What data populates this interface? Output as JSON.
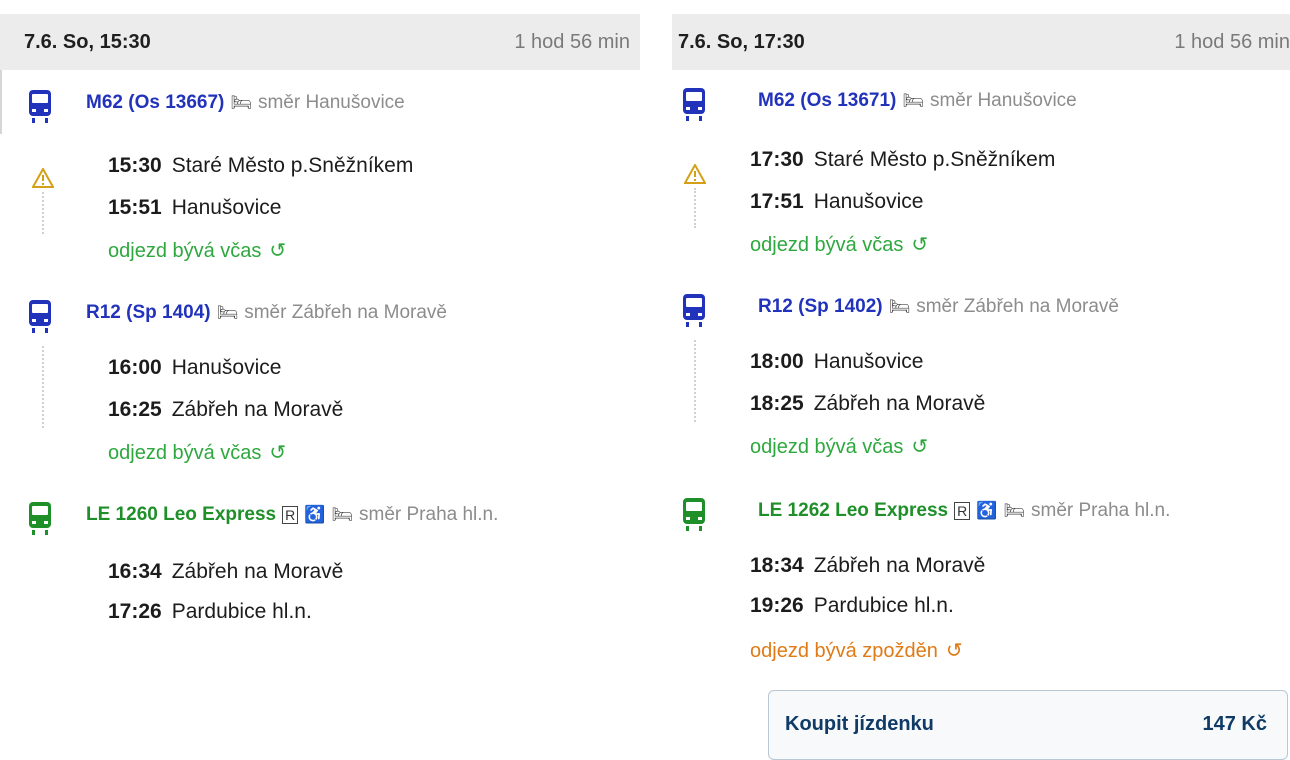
{
  "left": {
    "header": {
      "date": "7.6. So, 15:30",
      "duration": "1 hod 56 min"
    },
    "segments": [
      {
        "code": "M62 (Os 13667)",
        "direction": "směr Hanušovice",
        "stops": [
          {
            "time": "15:30",
            "station": "Staré Město p.Sněžníkem"
          },
          {
            "time": "15:51",
            "station": "Hanušovice"
          }
        ],
        "status": "odjezd bývá včas"
      },
      {
        "code": "R12 (Sp 1404)",
        "direction": "směr Zábřeh na Moravě",
        "stops": [
          {
            "time": "16:00",
            "station": "Hanušovice"
          },
          {
            "time": "16:25",
            "station": "Zábřeh na Moravě"
          }
        ],
        "status": "odjezd bývá včas"
      },
      {
        "code": "LE 1260 Leo Express",
        "reservation": "R",
        "direction": "směr Praha hl.n.",
        "stops": [
          {
            "time": "16:34",
            "station": "Zábřeh na Moravě"
          },
          {
            "time": "17:26",
            "station": "Pardubice hl.n."
          }
        ]
      }
    ]
  },
  "right": {
    "header": {
      "date": "7.6. So, 17:30",
      "duration": "1 hod 56 min"
    },
    "segments": [
      {
        "code": "M62 (Os 13671)",
        "direction": "směr Hanušovice",
        "stops": [
          {
            "time": "17:30",
            "station": "Staré Město p.Sněžníkem"
          },
          {
            "time": "17:51",
            "station": "Hanušovice"
          }
        ],
        "status": "odjezd bývá včas"
      },
      {
        "code": "R12 (Sp 1402)",
        "direction": "směr Zábřeh na Moravě",
        "stops": [
          {
            "time": "18:00",
            "station": "Hanušovice"
          },
          {
            "time": "18:25",
            "station": "Zábřeh na Moravě"
          }
        ],
        "status": "odjezd bývá včas"
      },
      {
        "code": "LE 1262 Leo Express",
        "reservation": "R",
        "direction": "směr Praha hl.n.",
        "stops": [
          {
            "time": "18:34",
            "station": "Zábřeh na Moravě"
          },
          {
            "time": "19:26",
            "station": "Pardubice hl.n."
          }
        ],
        "status": "odjezd bývá zpožděn"
      }
    ],
    "buy": {
      "label": "Koupit jízdenku",
      "price": "147 Kč"
    }
  },
  "icons": {
    "train": "train-icon",
    "warning": "warning-icon",
    "history": "history-icon",
    "wheelchair": "wheelchair-icon",
    "bed": "bed-icon"
  },
  "colors": {
    "regional": "#2233bb",
    "leo": "#1f8f2a",
    "on_time": "#2ea83e",
    "delayed": "#e07a16",
    "buy_text": "#0f3b66"
  }
}
